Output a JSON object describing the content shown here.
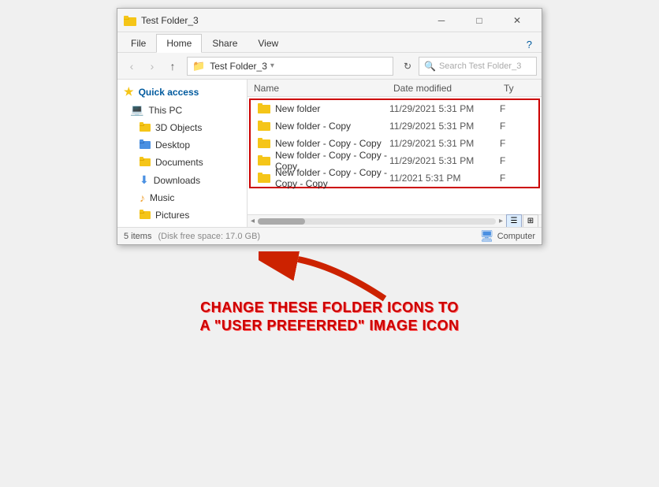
{
  "window": {
    "title": "Test Folder_3",
    "icon": "📁"
  },
  "titlebar": {
    "minimize": "─",
    "maximize": "□",
    "close": "✕"
  },
  "ribbon": {
    "tabs": [
      "File",
      "Home",
      "Share",
      "View"
    ],
    "active_tab": "Home",
    "help": "?"
  },
  "toolbar": {
    "back": "‹",
    "forward": "›",
    "up": "↑",
    "address": "Test Folder_3",
    "refresh": "⟳",
    "search_placeholder": "Search Test Folder_3"
  },
  "sidebar": {
    "quick_access_label": "Quick access",
    "items": [
      {
        "label": "This PC",
        "icon": "💻",
        "type": "pc"
      },
      {
        "label": "3D Objects",
        "icon": "📦",
        "type": "folder"
      },
      {
        "label": "Desktop",
        "icon": "🖥",
        "type": "folder"
      },
      {
        "label": "Documents",
        "icon": "📄",
        "type": "folder"
      },
      {
        "label": "Downloads",
        "icon": "⬇",
        "type": "folder"
      },
      {
        "label": "Music",
        "icon": "♪",
        "type": "folder"
      },
      {
        "label": "Pictures",
        "icon": "🖼",
        "type": "folder"
      }
    ]
  },
  "file_list": {
    "columns": {
      "name": "Name",
      "date_modified": "Date modified",
      "type": "Ty"
    },
    "rows": [
      {
        "name": "New folder",
        "date": "11/29/2021 5:31 PM",
        "type": "F"
      },
      {
        "name": "New folder - Copy",
        "date": "11/29/2021 5:31 PM",
        "type": "F"
      },
      {
        "name": "New folder - Copy - Copy",
        "date": "11/29/2021 5:31 PM",
        "type": "F"
      },
      {
        "name": "New folder - Copy - Copy - Copy",
        "date": "11/29/2021 5:31 PM",
        "type": "F"
      },
      {
        "name": "New folder - Copy - Copy - Copy - Copy",
        "date": "11/2021 5:31 PM",
        "type": "F"
      }
    ]
  },
  "status_bar": {
    "items_count": "5 items",
    "disk_space": "5 items (Disk free space: 17.0 GB)",
    "location": "Computer"
  },
  "annotation": {
    "line1": "CHANGE THESE FOLDER ICONS TO",
    "line2": "A \"USER PREFERRED\" IMAGE ICON"
  }
}
